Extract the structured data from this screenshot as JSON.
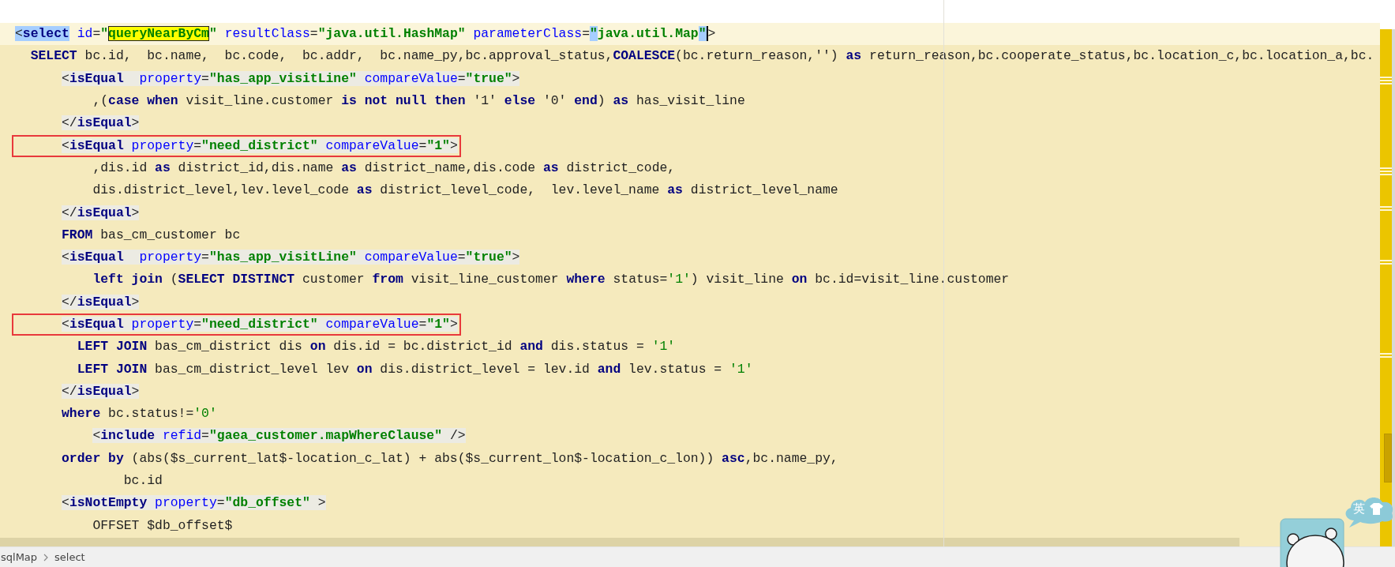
{
  "editor": {
    "lines": [
      {
        "current": true,
        "markup": false,
        "boxed": false,
        "tokens": [
          {
            "kind": "punct",
            "text": "<",
            "selected": true,
            "match": false,
            "caret": false
          },
          {
            "kind": "tag",
            "text": "select",
            "selected": true,
            "match": false,
            "caret": false
          },
          {
            "kind": "attr",
            "text": " id",
            "selected": false,
            "match": false,
            "caret": false
          },
          {
            "kind": "punct",
            "text": "=",
            "selected": false,
            "match": false,
            "caret": false
          },
          {
            "kind": "value",
            "text": "\"",
            "selected": false,
            "match": false,
            "caret": false
          },
          {
            "kind": "value",
            "text": "queryNearByCm",
            "selected": false,
            "match": true,
            "caret": false
          },
          {
            "kind": "value",
            "text": "\"",
            "selected": false,
            "match": false,
            "caret": false
          },
          {
            "kind": "attr",
            "text": " resultClass",
            "selected": false,
            "match": false,
            "caret": false
          },
          {
            "kind": "punct",
            "text": "=",
            "selected": false,
            "match": false,
            "caret": false
          },
          {
            "kind": "value",
            "text": "\"java.util.HashMap\"",
            "selected": false,
            "match": false,
            "caret": false
          },
          {
            "kind": "attr",
            "text": " parameterClass",
            "selected": false,
            "match": false,
            "caret": false
          },
          {
            "kind": "punct",
            "text": "=",
            "selected": false,
            "match": false,
            "caret": false
          },
          {
            "kind": "value",
            "text": "\"",
            "selected": true,
            "match": false,
            "caret": false
          },
          {
            "kind": "value",
            "text": "java.util.Map",
            "selected": false,
            "match": false,
            "caret": false
          },
          {
            "kind": "value",
            "text": "\"",
            "selected": true,
            "match": false,
            "caret": true
          },
          {
            "kind": "punct",
            "text": ">",
            "selected": false,
            "match": false,
            "caret": false
          }
        ]
      },
      {
        "current": false,
        "markup": false,
        "boxed": false,
        "tokens": [
          {
            "kind": "keyword",
            "text": "  SELECT"
          },
          {
            "kind": "plain",
            "text": " bc.id,  bc.name,  bc.code,  bc.addr,  bc.name_py,bc.approval_status,"
          },
          {
            "kind": "keyword",
            "text": "COALESCE"
          },
          {
            "kind": "plain",
            "text": "(bc.return_reason,'') "
          },
          {
            "kind": "keyword",
            "text": "as"
          },
          {
            "kind": "plain",
            "text": " return_reason,bc.cooperate_status,bc.location_c,bc.location_a,bc."
          }
        ]
      },
      {
        "current": false,
        "markup": true,
        "boxed": false,
        "tokens": [
          {
            "kind": "punct",
            "text": "      <"
          },
          {
            "kind": "tag",
            "text": "isEqual"
          },
          {
            "kind": "attr",
            "text": "  property"
          },
          {
            "kind": "punct",
            "text": "="
          },
          {
            "kind": "value",
            "text": "\"has_app_visitLine\""
          },
          {
            "kind": "attr",
            "text": " compareValue"
          },
          {
            "kind": "punct",
            "text": "="
          },
          {
            "kind": "value",
            "text": "\"true\""
          },
          {
            "kind": "punct",
            "text": ">"
          }
        ]
      },
      {
        "current": false,
        "markup": false,
        "boxed": false,
        "tokens": [
          {
            "kind": "plain",
            "text": "          ,("
          },
          {
            "kind": "keyword",
            "text": "case when"
          },
          {
            "kind": "plain",
            "text": " visit_line.customer "
          },
          {
            "kind": "keyword",
            "text": "is not null then"
          },
          {
            "kind": "plain",
            "text": " '1' "
          },
          {
            "kind": "keyword",
            "text": "else"
          },
          {
            "kind": "plain",
            "text": " '0' "
          },
          {
            "kind": "keyword",
            "text": "end"
          },
          {
            "kind": "plain",
            "text": ") "
          },
          {
            "kind": "keyword",
            "text": "as"
          },
          {
            "kind": "plain",
            "text": " has_visit_line"
          }
        ]
      },
      {
        "current": false,
        "markup": true,
        "boxed": false,
        "tokens": [
          {
            "kind": "punct",
            "text": "      </"
          },
          {
            "kind": "tag",
            "text": "isEqual"
          },
          {
            "kind": "punct",
            "text": ">"
          }
        ]
      },
      {
        "current": false,
        "markup": true,
        "boxed": true,
        "tokens": [
          {
            "kind": "punct",
            "text": "      <"
          },
          {
            "kind": "tag",
            "text": "isEqual"
          },
          {
            "kind": "attr",
            "text": " property"
          },
          {
            "kind": "punct",
            "text": "="
          },
          {
            "kind": "value",
            "text": "\"need_district\""
          },
          {
            "kind": "attr",
            "text": " compareValue"
          },
          {
            "kind": "punct",
            "text": "="
          },
          {
            "kind": "value",
            "text": "\"1\""
          },
          {
            "kind": "punct",
            "text": ">"
          }
        ]
      },
      {
        "current": false,
        "markup": false,
        "boxed": false,
        "tokens": [
          {
            "kind": "plain",
            "text": "          ,dis.id "
          },
          {
            "kind": "keyword",
            "text": "as"
          },
          {
            "kind": "plain",
            "text": " district_id,dis.name "
          },
          {
            "kind": "keyword",
            "text": "as"
          },
          {
            "kind": "plain",
            "text": " district_name,dis.code "
          },
          {
            "kind": "keyword",
            "text": "as"
          },
          {
            "kind": "plain",
            "text": " district_code,"
          }
        ]
      },
      {
        "current": false,
        "markup": false,
        "boxed": false,
        "tokens": [
          {
            "kind": "plain",
            "text": "          dis.district_level,lev.level_code "
          },
          {
            "kind": "keyword",
            "text": "as"
          },
          {
            "kind": "plain",
            "text": " district_level_code,  lev.level_name "
          },
          {
            "kind": "keyword",
            "text": "as"
          },
          {
            "kind": "plain",
            "text": " district_level_name"
          }
        ]
      },
      {
        "current": false,
        "markup": true,
        "boxed": false,
        "tokens": [
          {
            "kind": "punct",
            "text": "      </"
          },
          {
            "kind": "tag",
            "text": "isEqual"
          },
          {
            "kind": "punct",
            "text": ">"
          }
        ]
      },
      {
        "current": false,
        "markup": false,
        "boxed": false,
        "tokens": [
          {
            "kind": "keyword",
            "text": "      FROM"
          },
          {
            "kind": "plain",
            "text": " bas_cm_customer bc"
          }
        ]
      },
      {
        "current": false,
        "markup": true,
        "boxed": false,
        "tokens": [
          {
            "kind": "punct",
            "text": "      <"
          },
          {
            "kind": "tag",
            "text": "isEqual"
          },
          {
            "kind": "attr",
            "text": "  property"
          },
          {
            "kind": "punct",
            "text": "="
          },
          {
            "kind": "value",
            "text": "\"has_app_visitLine\""
          },
          {
            "kind": "attr",
            "text": " compareValue"
          },
          {
            "kind": "punct",
            "text": "="
          },
          {
            "kind": "value",
            "text": "\"true\""
          },
          {
            "kind": "punct",
            "text": ">"
          }
        ]
      },
      {
        "current": false,
        "markup": false,
        "boxed": false,
        "tokens": [
          {
            "kind": "keyword",
            "text": "          left join"
          },
          {
            "kind": "plain",
            "text": " ("
          },
          {
            "kind": "keyword",
            "text": "SELECT DISTINCT"
          },
          {
            "kind": "plain",
            "text": " customer "
          },
          {
            "kind": "keyword",
            "text": "from"
          },
          {
            "kind": "plain",
            "text": " visit_line_customer "
          },
          {
            "kind": "keyword",
            "text": "where"
          },
          {
            "kind": "plain",
            "text": " status="
          },
          {
            "kind": "string",
            "text": "'1'"
          },
          {
            "kind": "plain",
            "text": ") visit_line "
          },
          {
            "kind": "keyword",
            "text": "on"
          },
          {
            "kind": "plain",
            "text": " bc.id=visit_line.customer"
          }
        ]
      },
      {
        "current": false,
        "markup": true,
        "boxed": false,
        "tokens": [
          {
            "kind": "punct",
            "text": "      </"
          },
          {
            "kind": "tag",
            "text": "isEqual"
          },
          {
            "kind": "punct",
            "text": ">"
          }
        ]
      },
      {
        "current": false,
        "markup": true,
        "boxed": true,
        "tokens": [
          {
            "kind": "punct",
            "text": "      <"
          },
          {
            "kind": "tag",
            "text": "isEqual"
          },
          {
            "kind": "attr",
            "text": " property"
          },
          {
            "kind": "punct",
            "text": "="
          },
          {
            "kind": "value",
            "text": "\"need_district\""
          },
          {
            "kind": "attr",
            "text": " compareValue"
          },
          {
            "kind": "punct",
            "text": "="
          },
          {
            "kind": "value",
            "text": "\"1\""
          },
          {
            "kind": "punct",
            "text": ">"
          }
        ]
      },
      {
        "current": false,
        "markup": false,
        "boxed": false,
        "tokens": [
          {
            "kind": "keyword",
            "text": "        LEFT JOIN"
          },
          {
            "kind": "plain",
            "text": " bas_cm_district dis "
          },
          {
            "kind": "keyword",
            "text": "on"
          },
          {
            "kind": "plain",
            "text": " dis.id = bc.district_id "
          },
          {
            "kind": "keyword",
            "text": "and"
          },
          {
            "kind": "plain",
            "text": " dis.status = "
          },
          {
            "kind": "string",
            "text": "'1'"
          }
        ]
      },
      {
        "current": false,
        "markup": false,
        "boxed": false,
        "tokens": [
          {
            "kind": "keyword",
            "text": "        LEFT JOIN"
          },
          {
            "kind": "plain",
            "text": " bas_cm_district_level lev "
          },
          {
            "kind": "keyword",
            "text": "on"
          },
          {
            "kind": "plain",
            "text": " dis.district_level = lev.id "
          },
          {
            "kind": "keyword",
            "text": "and"
          },
          {
            "kind": "plain",
            "text": " lev.status = "
          },
          {
            "kind": "string",
            "text": "'1'"
          }
        ]
      },
      {
        "current": false,
        "markup": true,
        "boxed": false,
        "tokens": [
          {
            "kind": "punct",
            "text": "      </"
          },
          {
            "kind": "tag",
            "text": "isEqual"
          },
          {
            "kind": "punct",
            "text": ">"
          }
        ]
      },
      {
        "current": false,
        "markup": false,
        "boxed": false,
        "tokens": [
          {
            "kind": "keyword",
            "text": "      where"
          },
          {
            "kind": "plain",
            "text": " bc.status!="
          },
          {
            "kind": "string",
            "text": "'0'"
          }
        ]
      },
      {
        "current": false,
        "markup": true,
        "boxed": false,
        "tokens": [
          {
            "kind": "punct",
            "text": "          <"
          },
          {
            "kind": "tag",
            "text": "include"
          },
          {
            "kind": "attr",
            "text": " refid"
          },
          {
            "kind": "punct",
            "text": "="
          },
          {
            "kind": "value",
            "text": "\"gaea_customer.mapWhereClause\""
          },
          {
            "kind": "punct",
            "text": " />"
          }
        ]
      },
      {
        "current": false,
        "markup": false,
        "boxed": false,
        "tokens": [
          {
            "kind": "keyword",
            "text": "      order by"
          },
          {
            "kind": "plain",
            "text": " (abs($s_current_lat$-location_c_lat) + abs($s_current_lon$-location_c_lon)) "
          },
          {
            "kind": "keyword",
            "text": "asc"
          },
          {
            "kind": "plain",
            "text": ",bc.name_py,"
          }
        ]
      },
      {
        "current": false,
        "markup": false,
        "boxed": false,
        "tokens": [
          {
            "kind": "plain",
            "text": "              bc.id"
          }
        ]
      },
      {
        "current": false,
        "markup": true,
        "boxed": false,
        "tokens": [
          {
            "kind": "punct",
            "text": "      <"
          },
          {
            "kind": "tag",
            "text": "isNotEmpty"
          },
          {
            "kind": "attr",
            "text": " property"
          },
          {
            "kind": "punct",
            "text": "="
          },
          {
            "kind": "value",
            "text": "\"db_offset\""
          },
          {
            "kind": "punct",
            "text": " >"
          }
        ]
      },
      {
        "current": false,
        "markup": false,
        "boxed": false,
        "tokens": [
          {
            "kind": "plain",
            "text": "          OFFSET $db_offset$"
          }
        ]
      }
    ]
  },
  "breadcrumb": [
    "sqlMap",
    "select"
  ],
  "ime": {
    "label": "英"
  }
}
